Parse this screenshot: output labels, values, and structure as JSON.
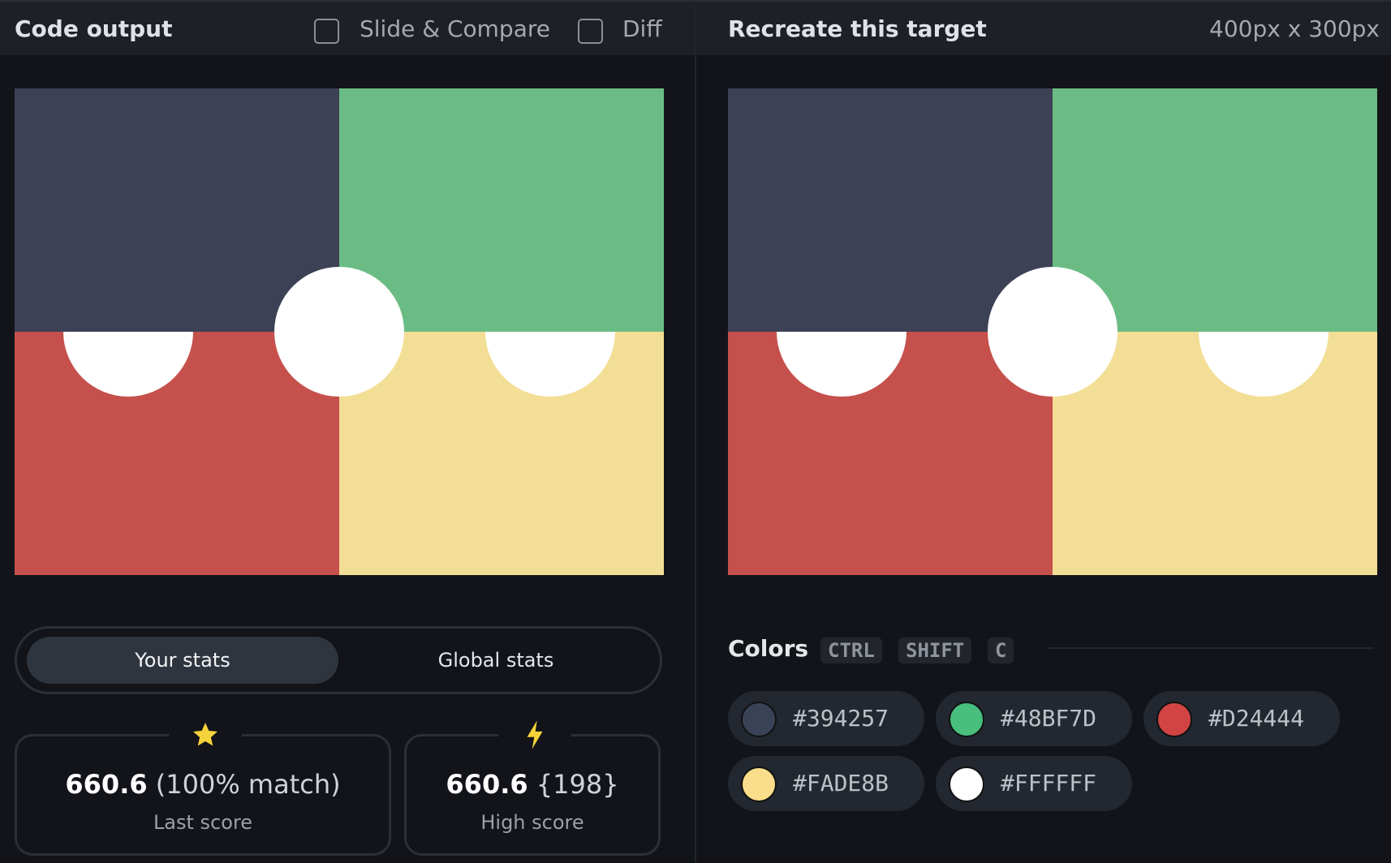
{
  "left": {
    "title": "Code output",
    "slide_compare": {
      "label": "Slide & Compare",
      "checked": false
    },
    "diff": {
      "label": "Diff",
      "checked": false
    }
  },
  "right": {
    "title": "Recreate this target",
    "dimensions": "400px x 300px"
  },
  "tabs": {
    "your_stats": "Your stats",
    "global_stats": "Global stats",
    "active": "your_stats"
  },
  "stats": {
    "last": {
      "score": "660.6",
      "detail": "(100% match)",
      "label": "Last score",
      "icon": "star-icon"
    },
    "high": {
      "score": "660.6",
      "detail": "{198}",
      "label": "High score",
      "icon": "lightning-icon"
    }
  },
  "colors": {
    "title": "Colors",
    "shortcut": [
      "CTRL",
      "SHIFT",
      "C"
    ],
    "palette": [
      {
        "hex": "#394257"
      },
      {
        "hex": "#48BF7D"
      },
      {
        "hex": "#D24444"
      },
      {
        "hex": "#FADE8B"
      },
      {
        "hex": "#FFFFFF"
      }
    ]
  }
}
